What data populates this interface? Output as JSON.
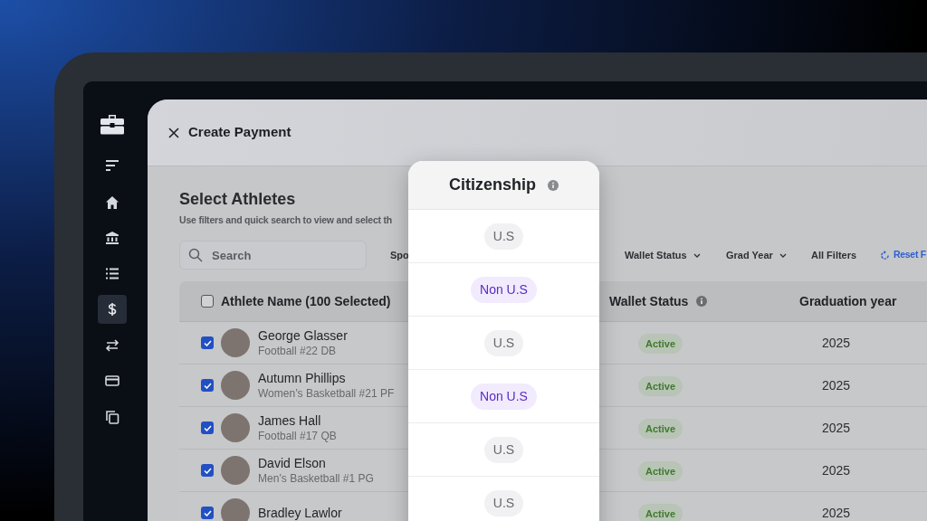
{
  "sidebar": {
    "items": [
      {
        "selected": false
      },
      {
        "selected": false
      },
      {
        "selected": false
      },
      {
        "selected": false
      },
      {
        "selected": true
      },
      {
        "selected": false
      },
      {
        "selected": false
      },
      {
        "selected": false
      }
    ]
  },
  "dialog": {
    "title": "Create Payment"
  },
  "section": {
    "title": "Select Athletes",
    "subtitle": "Use filters and quick search to view and select th"
  },
  "search": {
    "placeholder": "Search"
  },
  "filters": [
    {
      "label": "Spo"
    },
    {
      "label": "Wallet Status",
      "dropdown": true
    },
    {
      "label": "Grad Year",
      "dropdown": true
    },
    {
      "label": "All Filters",
      "dropdown": false
    }
  ],
  "reset": {
    "label": "Reset F"
  },
  "table": {
    "select_all": {
      "checked": false
    },
    "columns": [
      {
        "label": "Athlete Name (100 Selected)",
        "info": false
      },
      {
        "label": "Wallet Status",
        "info": true
      },
      {
        "label": "Graduation year",
        "info": false
      }
    ],
    "rows": [
      {
        "name": "George Glasser",
        "detail": "Football #22 DB",
        "checked": true,
        "wallet_status": "Active",
        "grad_year": "2025"
      },
      {
        "name": "Autumn Phillips",
        "detail": "Women’s Basketball  #21 PF",
        "checked": true,
        "wallet_status": "Active",
        "grad_year": "2025"
      },
      {
        "name": "James Hall",
        "detail": "Football #17 QB",
        "checked": true,
        "wallet_status": "Active",
        "grad_year": "2025"
      },
      {
        "name": "David Elson",
        "detail": "Men’s Basketball #1 PG",
        "checked": true,
        "wallet_status": "Active",
        "grad_year": "2025"
      },
      {
        "name": "Bradley Lawlor",
        "checked": true,
        "wallet_status": "Active",
        "grad_year": "2025"
      }
    ]
  },
  "citizenship": {
    "title": "Citizenship",
    "info": true,
    "values": [
      {
        "label": "U.S",
        "kind": "us"
      },
      {
        "label": "Non U.S",
        "kind": "non_us"
      },
      {
        "label": "U.S",
        "kind": "us"
      },
      {
        "label": "Non U.S",
        "kind": "non_us"
      },
      {
        "label": "U.S",
        "kind": "us"
      },
      {
        "label": "U.S",
        "kind": "us"
      }
    ]
  }
}
